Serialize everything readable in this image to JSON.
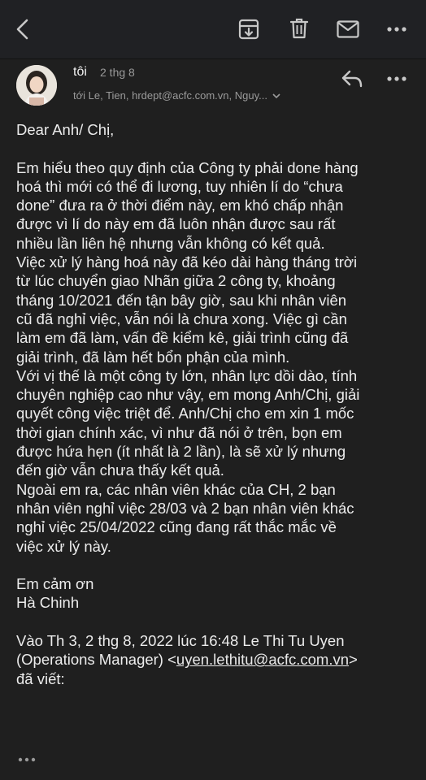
{
  "toolbar": {
    "back_icon": "chevron-left-icon",
    "archive_icon": "archive-icon",
    "delete_icon": "trash-icon",
    "mark_unread_icon": "envelope-icon",
    "more_icon": "more-horizontal-icon"
  },
  "message": {
    "sender": "tôi",
    "date": "2 thg 8",
    "recipients": "tới Le, Tien, hrdept@acfc.com.vn, Nguy...",
    "reply_icon": "reply-icon",
    "more_icon": "more-horizontal-icon",
    "avatar_icon": "avatar"
  },
  "body": {
    "greeting": "Dear Anh/ Chị,",
    "p1": [
      "Em hiểu theo quy định của Công ty phải done hàng",
      "hoá thì mới có thể đi lương, tuy nhiên lí do “chưa",
      "done” đưa ra ở thời điểm này, em khó chấp nhận",
      "được vì lí do này em đã luôn nhận được sau rất",
      "nhiều lần liên hệ nhưng vẫn không có kết quả.",
      "Việc xử lý hàng hoá này đã kéo dài hàng tháng trời",
      "từ lúc chuyển giao Nhãn giữa 2 công ty, khoảng",
      "tháng 10/2021 đến tận bây giờ, sau khi nhân viên",
      "cũ đã nghỉ việc, vẫn nói là chưa xong. Việc gì cần",
      "làm em đã làm, vấn đề kiểm kê, giải trình cũng đã",
      "giải trình, đã làm hết bổn phận của mình.",
      "Với vị thế là một công ty lớn, nhân lực dồi dào, tính",
      "chuyên nghiệp cao như vậy, em mong Anh/Chị, giải",
      "quyết công việc triệt để. Anh/Chị cho em xin 1 mốc",
      "thời gian chính xác, vì như đã nói ở trên, bọn em",
      "được hứa hẹn (ít nhất là 2 lần), là sẽ xử lý nhưng",
      "đến giờ vẫn chưa thấy kết quả.",
      "Ngoài em ra, các nhân viên khác của CH, 2 bạn",
      "nhân viên nghỉ việc 28/03 và 2 bạn nhân viên khác",
      "nghỉ việc 25/04/2022 cũng đang rất thắc mắc về",
      "việc xử lý này."
    ],
    "thanks": "Em cảm ơn",
    "signature": "Hà Chinh",
    "quote_line1": "Vào Th 3, 2 thg 8, 2022 lúc 16:48 Le Thi Tu Uyen",
    "quote_line2_prefix": "(Operations Manager) <",
    "quote_email": "uyen.lethitu@acfc.com.vn",
    "quote_line2_suffix": ">",
    "quote_line3": "đã viết:",
    "trimmed_icon": "ellipsis-icon"
  }
}
